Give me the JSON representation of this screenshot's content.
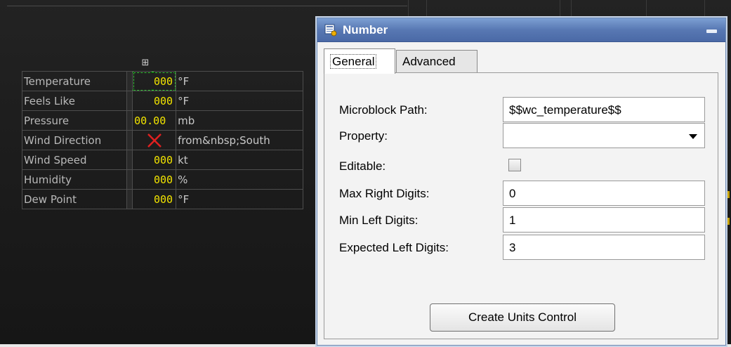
{
  "weather": {
    "rows": [
      {
        "label": "Temperature",
        "value": "000",
        "unit": "°F"
      },
      {
        "label": "Feels Like",
        "value": "000",
        "unit": "°F"
      },
      {
        "label": "Pressure",
        "value": "00.00",
        "unit": "mb"
      },
      {
        "label": "Wind Direction",
        "value": "",
        "unit": "from&nbsp;South"
      },
      {
        "label": "Wind Speed",
        "value": "000",
        "unit": "kt"
      },
      {
        "label": "Humidity",
        "value": "000",
        "unit": "%"
      },
      {
        "label": "Dew Point",
        "value": "000",
        "unit": "°F"
      }
    ],
    "value_color": "#f2e400",
    "label_color": "#b9b9b9"
  },
  "dialog": {
    "title": "Number",
    "tabs": [
      {
        "label": "General",
        "active": true
      },
      {
        "label": "Advanced",
        "active": false
      }
    ],
    "fields": {
      "microblock_path": {
        "label": "Microblock Path:",
        "value": "$$wc_temperature$$"
      },
      "property": {
        "label": "Property:",
        "value": ""
      },
      "editable": {
        "label": "Editable:",
        "checked": false
      },
      "max_right_digits": {
        "label": "Max Right Digits:",
        "value": "0"
      },
      "min_left_digits": {
        "label": "Min Left Digits:",
        "value": "1"
      },
      "expected_left_digits": {
        "label": "Expected Left Digits:",
        "value": "3"
      }
    },
    "create_button": "Create Units Control",
    "titlebar_color": "#5878b3"
  }
}
